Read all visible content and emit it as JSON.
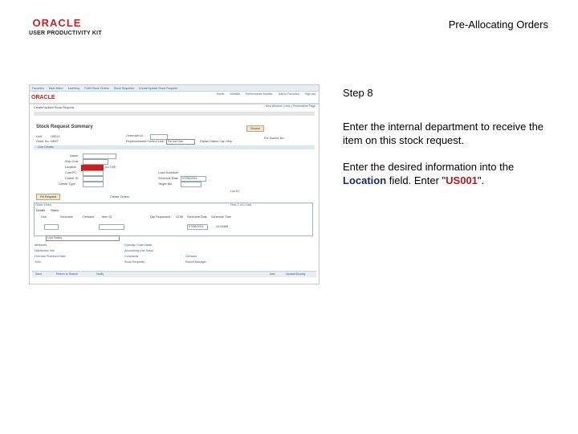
{
  "brand": {
    "logo_text": "ORACLE",
    "logo_sub": "USER PRODUCTIVITY KIT"
  },
  "header": {
    "title": "Pre-Allocating Orders"
  },
  "instructions": {
    "step": "Step 8",
    "para1": "Enter the internal department to receive the item on this stock request.",
    "para2_prefix": "Enter the desired information into the ",
    "para2_field": "Location",
    "para2_middle": " field. Enter \"",
    "para2_value": "US001",
    "para2_suffix": "\"."
  },
  "screenshot": {
    "nav_items": [
      "Favorites",
      "Main Menu",
      "Inventory",
      "Fulfill Stock Orders",
      "Stock Requests",
      "Create/Update Stock Request"
    ],
    "top_links": [
      "Home",
      "Worklist",
      "Performance Monitor",
      "Add to Favorites",
      "Sign out"
    ],
    "oracle_mini": "ORACLE",
    "sub_links": "New Window | Help | Personalize Page",
    "breadcrumb": "Create/Update Stock Request",
    "page_heading": "Stock Request Summary",
    "buttons": {
      "source": "Source",
      "line_details": "Line Details",
      "fill_request": "Fill Request",
      "save": "Save",
      "return_to_search": "Return to Search"
    },
    "fields": {
      "unit_label": "Unit:",
      "unit_value": "US010",
      "order_no_label": "Order No:",
      "order_no_value": "NEXT",
      "shipment_label": "Overrride UL:",
      "replenishment_label": "Replenishment Control Line:",
      "replenishment_value": "Do not Use",
      "partial_label": "Partial Orders Can Ship",
      "sequence_label": "Ext Source No:",
      "name_label": "Name",
      "ship_cust_label": "Ship Cust",
      "location_label": "Location",
      "cust_po_label": "Cust PO",
      "carrier_id_label": "Carrier ID",
      "carrier_type_label": "Carrier Type",
      "load_label": "Load Schedule",
      "schedule_date_label": "Schedule Date",
      "schedule_date_value": "07/06/2011",
      "target_bid_label": "Target Bid",
      "dept_label": "Loc ID",
      "loc_value": "Add",
      "active_value": "ACTIVE",
      "create_orders": "Create Orders"
    },
    "grid": {
      "title": "Order Lines",
      "tabs": [
        "Details",
        "Status"
      ],
      "headers": [
        "Line",
        "Schedule",
        "Demand",
        "Item ID",
        "Qty Requested",
        "UOM",
        "Schedule Date",
        "Schedule Time"
      ],
      "row_values": [
        "1",
        "",
        "1",
        "",
        "",
        "",
        "07/06/2011",
        "12:00AM"
      ],
      "pagination": "First 1 of 1 Last"
    },
    "related_links": {
      "dropdown_label": "Line Notes",
      "col1": [
        "Attributes",
        "Distribution Info",
        "Override Promised Date",
        "ToDo"
      ],
      "col2": [
        "Quantity / Date Detail",
        "Accounting Line Setup",
        "Comments",
        "Stock Requests"
      ],
      "col3": [
        "",
        "",
        "Demand",
        "Report Manager"
      ]
    },
    "footer": {
      "save": "Save",
      "return": "Return to Search",
      "notify": "Notify",
      "add": "Add",
      "update_display": "Update/Display"
    }
  }
}
